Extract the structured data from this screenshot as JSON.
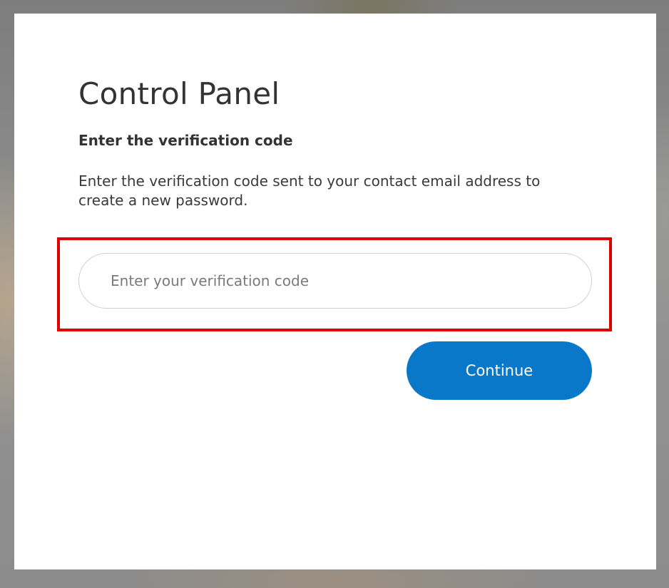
{
  "panel": {
    "title": "Control Panel",
    "subtitle": "Enter the verification code",
    "description": "Enter the verification code sent to your contact email address to create a new password."
  },
  "form": {
    "code_input": {
      "value": "",
      "placeholder": "Enter your verification code"
    },
    "continue_label": "Continue"
  },
  "colors": {
    "accent": "#0a78c8",
    "highlight": "#e00000",
    "text": "#333333"
  }
}
